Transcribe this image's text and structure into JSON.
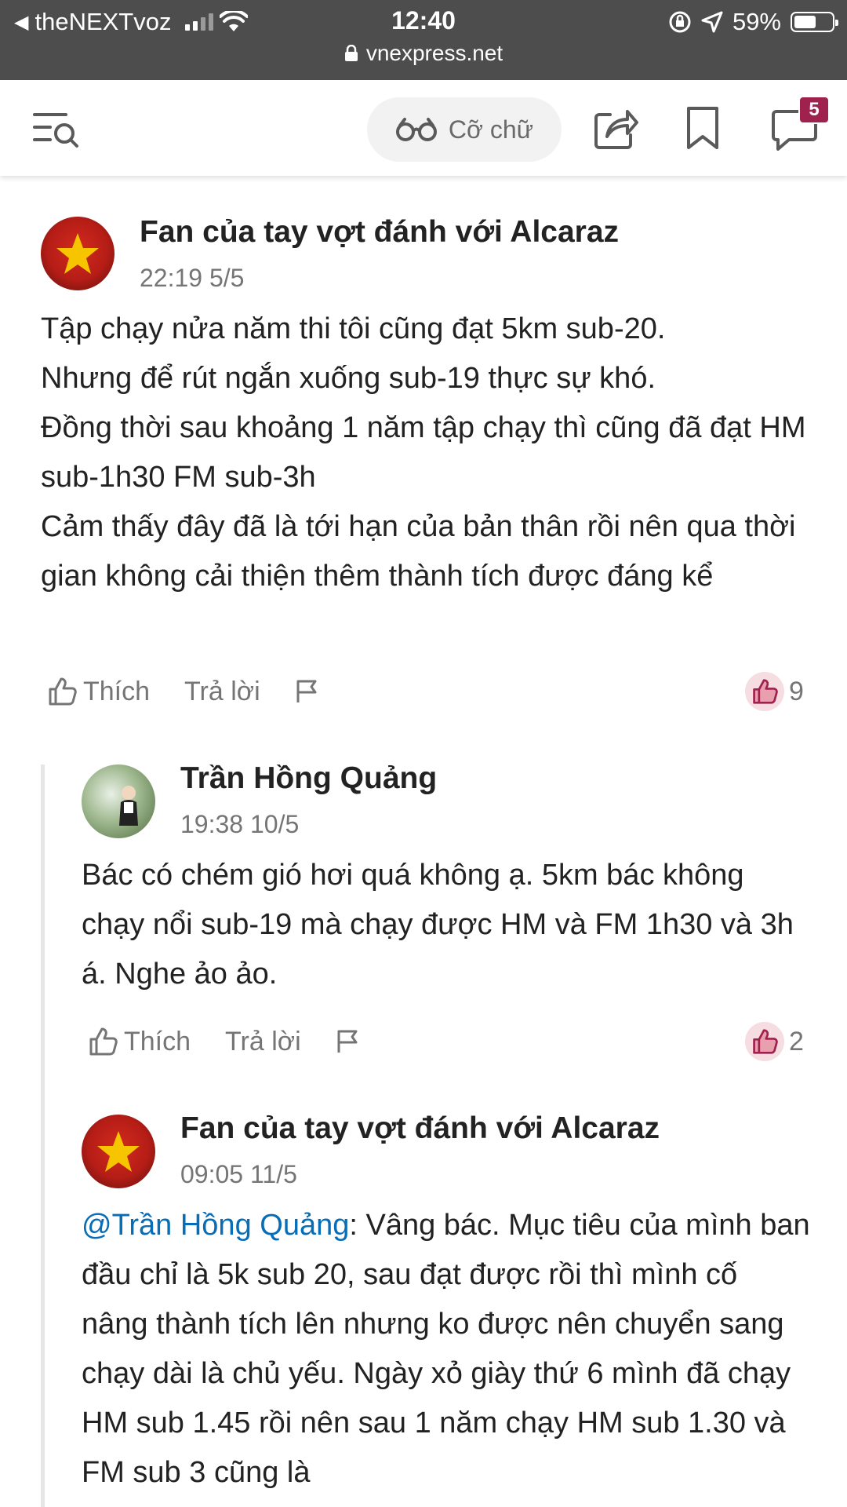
{
  "status_bar": {
    "carrier": "theNEXTvoz",
    "time": "12:40",
    "battery": "59%",
    "url": "vnexpress.net"
  },
  "toolbar": {
    "font_size_label": "Cỡ chữ",
    "comment_badge": "5"
  },
  "comments": [
    {
      "author": "Fan của tay vợt đánh với Alcaraz",
      "time": "22:19 5/5",
      "body": "Tập chạy nửa năm thi tôi cũng đạt 5km sub-20.\nNhưng để rút ngắn xuống sub-19 thực sự khó.\nĐồng thời sau khoảng 1 năm tập chạy thì cũng đã đạt HM sub-1h30 FM sub-3h\nCảm thấy đây đã là tới hạn của bản thân rồi nên qua thời gian không cải thiện thêm thành tích được đáng kể",
      "like_label": "Thích",
      "reply_label": "Trả lời",
      "likes": "9"
    },
    {
      "author": "Trần Hồng Quảng",
      "time": "19:38 10/5",
      "body": "Bác có chém gió hơi quá không ạ. 5km bác không chạy nổi sub-19 mà chạy được HM và FM 1h30 và 3h á. Nghe ảo ảo.",
      "like_label": "Thích",
      "reply_label": "Trả lời",
      "likes": "2"
    },
    {
      "author": "Fan của tay vợt đánh với Alcaraz",
      "time": "09:05 11/5",
      "mention": "@Trần Hồng Quảng",
      "body": ": Vâng bác. Mục tiêu của mình ban đầu chỉ là 5k sub 20, sau đạt được rồi thì mình cố nâng thành tích lên nhưng ko được nên chuyển sang chạy dài là chủ yếu. Ngày xỏ giày thứ 6 mình đã chạy HM sub 1.45 rồi nên sau 1 năm chạy HM sub 1.30 và FM sub 3 cũng là"
    }
  ],
  "colors": {
    "status_bar_bg": "#4d4d4d",
    "brand_badge": "#9f224e",
    "mention": "#076db6",
    "like_bubble": "#f5dde2"
  }
}
